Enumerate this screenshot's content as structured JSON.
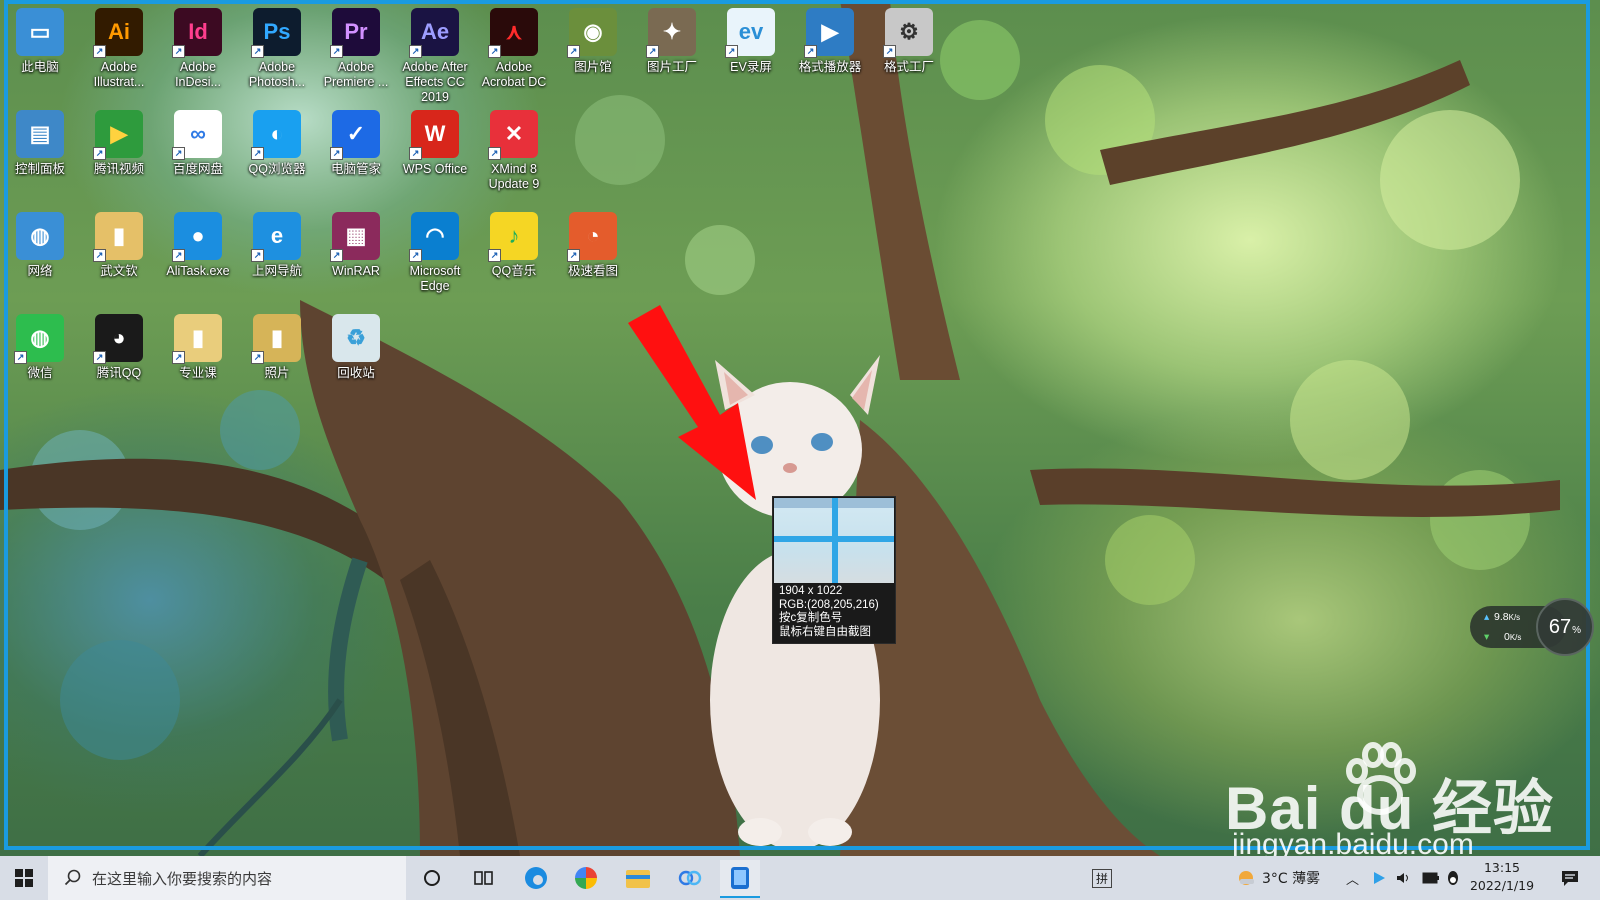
{
  "desktop": {
    "icons": [
      {
        "label": "此电脑",
        "icon": "computer-icon",
        "color": "#3a8fd6",
        "glyph": "▭"
      },
      {
        "label": "Adobe Illustrat...",
        "icon": "illustrator-icon",
        "color": "#321b00",
        "fg": "#ff9a00",
        "glyph": "Ai"
      },
      {
        "label": "Adobe InDesi...",
        "icon": "indesign-icon",
        "color": "#3c0a22",
        "fg": "#ff3e8e",
        "glyph": "Id"
      },
      {
        "label": "Adobe Photosh...",
        "icon": "photoshop-icon",
        "color": "#0d1c2e",
        "fg": "#31a8ff",
        "glyph": "Ps"
      },
      {
        "label": "Adobe Premiere ...",
        "icon": "premiere-icon",
        "color": "#1e0b3a",
        "fg": "#d291ff",
        "glyph": "Pr"
      },
      {
        "label": "Adobe After Effects CC 2019",
        "icon": "after-effects-icon",
        "color": "#1a1343",
        "fg": "#9d9dff",
        "glyph": "Ae"
      },
      {
        "label": "Adobe Acrobat DC",
        "icon": "acrobat-icon",
        "color": "#2a0a0a",
        "fg": "#ff2b2b",
        "glyph": "⋏"
      },
      {
        "label": "图片馆",
        "icon": "image-gallery-icon",
        "color": "#6b8f3c",
        "glyph": "◉"
      },
      {
        "label": "图片工厂",
        "icon": "image-factory-icon",
        "color": "#7a6a52",
        "glyph": "✦"
      },
      {
        "label": "EV录屏",
        "icon": "ev-recorder-icon",
        "color": "#e9f4fb",
        "fg": "#2b8fd6",
        "glyph": "ev"
      },
      {
        "label": "格式播放器",
        "icon": "format-player-icon",
        "color": "#2e7cc4",
        "glyph": "▶"
      },
      {
        "label": "格式工厂",
        "icon": "format-factory-icon",
        "color": "#c8c8c8",
        "fg": "#333",
        "glyph": "⚙"
      },
      {
        "label": "控制面板",
        "icon": "control-panel-icon",
        "color": "#3e88c8",
        "glyph": "▤"
      },
      {
        "label": "腾讯视频",
        "icon": "tencent-video-icon",
        "color": "#2e9b3d",
        "fg": "#ffd23f",
        "glyph": "▶"
      },
      {
        "label": "百度网盘",
        "icon": "baidu-netdisk-icon",
        "color": "#ffffff",
        "fg": "#2f7ae5",
        "glyph": "∞"
      },
      {
        "label": "QQ浏览器",
        "icon": "qq-browser-icon",
        "color": "#19a0f0",
        "glyph": "◐"
      },
      {
        "label": "电脑管家",
        "icon": "pc-manager-icon",
        "color": "#1d6ae5",
        "glyph": "✓"
      },
      {
        "label": "WPS Office",
        "icon": "wps-icon",
        "color": "#d8261b",
        "glyph": "W"
      },
      {
        "label": "XMind 8 Update 9",
        "icon": "xmind-icon",
        "color": "#e8303a",
        "glyph": "✕"
      },
      {
        "label": "网络",
        "icon": "network-icon",
        "color": "#3a8fd6",
        "glyph": "◍"
      },
      {
        "label": "武文钦",
        "icon": "user-folder-icon",
        "color": "#e5c068",
        "glyph": "▮"
      },
      {
        "label": "AliTask.exe",
        "icon": "alitask-icon",
        "color": "#1b8ee0",
        "glyph": "●"
      },
      {
        "label": "上网导航",
        "icon": "ie-icon",
        "color": "#1e90e0",
        "glyph": "e"
      },
      {
        "label": "WinRAR",
        "icon": "winrar-icon",
        "color": "#8b2a5c",
        "glyph": "▦"
      },
      {
        "label": "Microsoft Edge",
        "icon": "edge-icon",
        "color": "#0a7fd0",
        "glyph": "◠"
      },
      {
        "label": "QQ音乐",
        "icon": "qq-music-icon",
        "color": "#f5d624",
        "fg": "#1fae5a",
        "glyph": "♪"
      },
      {
        "label": "极速看图",
        "icon": "fast-viewer-icon",
        "color": "#e45c2c",
        "glyph": "◔"
      },
      {
        "label": "微信",
        "icon": "wechat-icon",
        "color": "#2dbd4e",
        "glyph": "◍"
      },
      {
        "label": "腾讯QQ",
        "icon": "qq-icon",
        "color": "#1a1a1a",
        "glyph": "◕"
      },
      {
        "label": "专业课",
        "icon": "folder-icon",
        "color": "#e9cd7c",
        "glyph": "▮"
      },
      {
        "label": "照片",
        "icon": "photos-folder-icon",
        "color": "#d6b458",
        "glyph": "▮"
      },
      {
        "label": "回收站",
        "icon": "recycle-bin-icon",
        "color": "#d9e7ec",
        "fg": "#3aa0d8",
        "glyph": "♻"
      }
    ]
  },
  "magnifier": {
    "size": "1904 x 1022",
    "rgb": "RGB:(208,205,216)",
    "copy_hint": "按c复制色号",
    "right_click_hint": "鼠标右键自由截图"
  },
  "net_widget": {
    "up": "9.8",
    "up_unit": "K/s",
    "down": "0",
    "down_unit": "K/s",
    "percent": "67",
    "percent_unit": "%"
  },
  "watermark": {
    "brand": "Bai du 经验",
    "url": "jingyan.baidu.com"
  },
  "taskbar": {
    "search_placeholder": "在这里输入你要搜索的内容",
    "weather": "3°C 薄雾",
    "time": "13:15",
    "date": "2022/1/19",
    "ime": "拼",
    "accent": "#1a9be0"
  }
}
